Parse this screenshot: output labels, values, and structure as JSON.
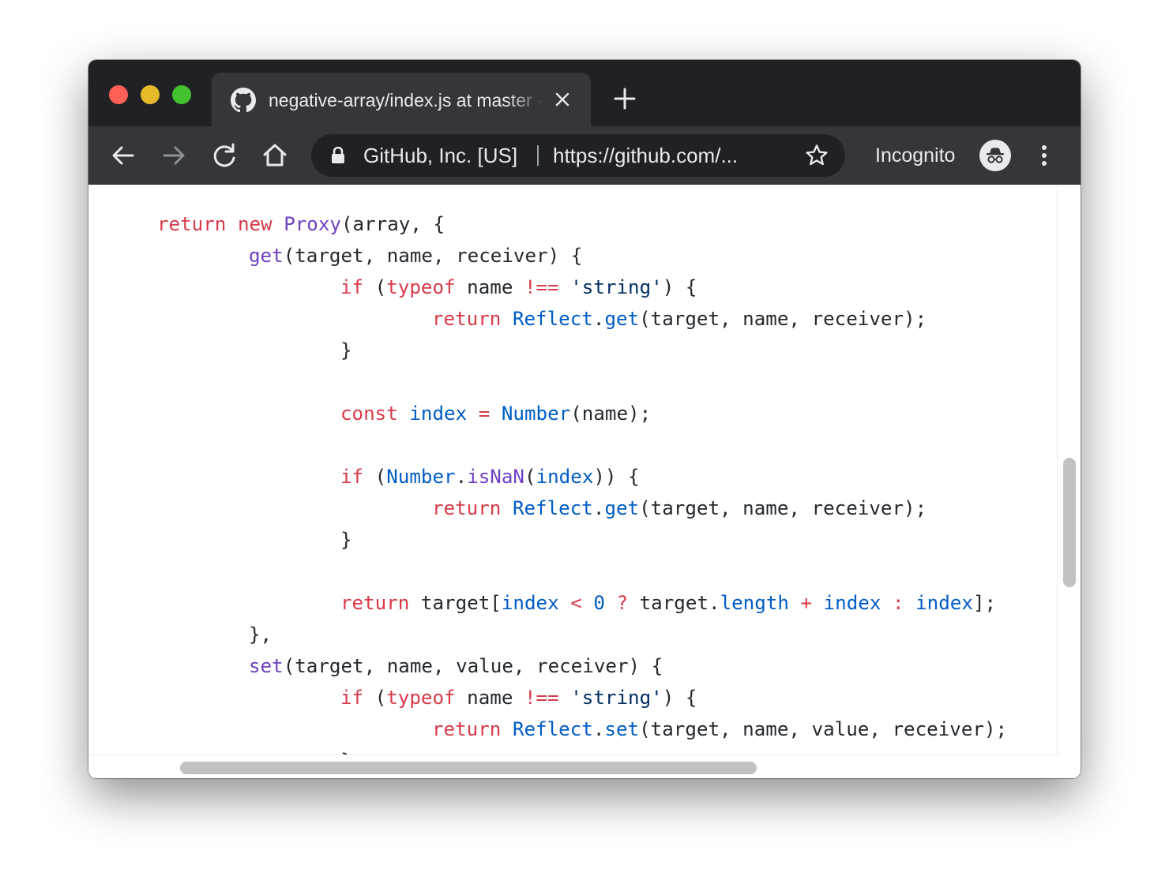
{
  "window": {
    "traffic_lights": [
      "close",
      "minimize",
      "maximize"
    ],
    "colors": {
      "close": "#fe5f57",
      "minimize": "#e5bb2a",
      "maximize": "#43c12f",
      "titlebar": "#202124",
      "toolbar": "#35363a"
    }
  },
  "tab": {
    "title": "negative-array/index.js at master · sindresorhus/negative-array",
    "favicon": "github-icon"
  },
  "toolbar": {
    "site_name": "GitHub, Inc. [US]",
    "url": "https://github.com/...",
    "incognito_label": "Incognito",
    "icons": [
      "back-icon",
      "forward-icon",
      "reload-icon",
      "home-icon",
      "lock-icon",
      "bookmark-star-icon",
      "incognito-icon",
      "menu-icon"
    ]
  },
  "code": {
    "theme_colors": {
      "keyword": "#d73a49",
      "function": "#6f42c1",
      "constant": "#005cc5",
      "string": "#032f62",
      "text": "#24292e"
    },
    "lines": [
      "\treturn new Proxy(array, {",
      "\t\tget(target, name, receiver) {",
      "\t\t\tif (typeof name !== 'string') {",
      "\t\t\t\treturn Reflect.get(target, name, receiver);",
      "\t\t\t}",
      "",
      "\t\t\tconst index = Number(name);",
      "",
      "\t\t\tif (Number.isNaN(index)) {",
      "\t\t\t\treturn Reflect.get(target, name, receiver);",
      "\t\t\t}",
      "",
      "\t\t\treturn target[index < 0 ? target.length + index : index];",
      "\t\t},",
      "\t\tset(target, name, value, receiver) {",
      "\t\t\tif (typeof name !== 'string') {",
      "\t\t\t\treturn Reflect.set(target, name, value, receiver);",
      "\t\t\t}"
    ]
  }
}
